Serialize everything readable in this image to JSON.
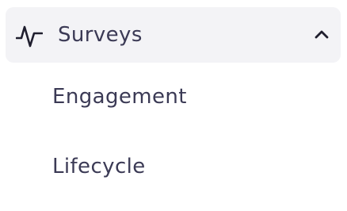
{
  "nav": {
    "group": {
      "label": "Surveys",
      "icon": "activity-icon",
      "expanded": true,
      "toggle_icon": "chevron-up-icon"
    },
    "items": [
      {
        "label": "Engagement"
      },
      {
        "label": "Lifecycle"
      }
    ]
  },
  "colors": {
    "text": "#3b3a55",
    "header_bg": "#f3f3f6",
    "icon": "#1f1e2e"
  }
}
